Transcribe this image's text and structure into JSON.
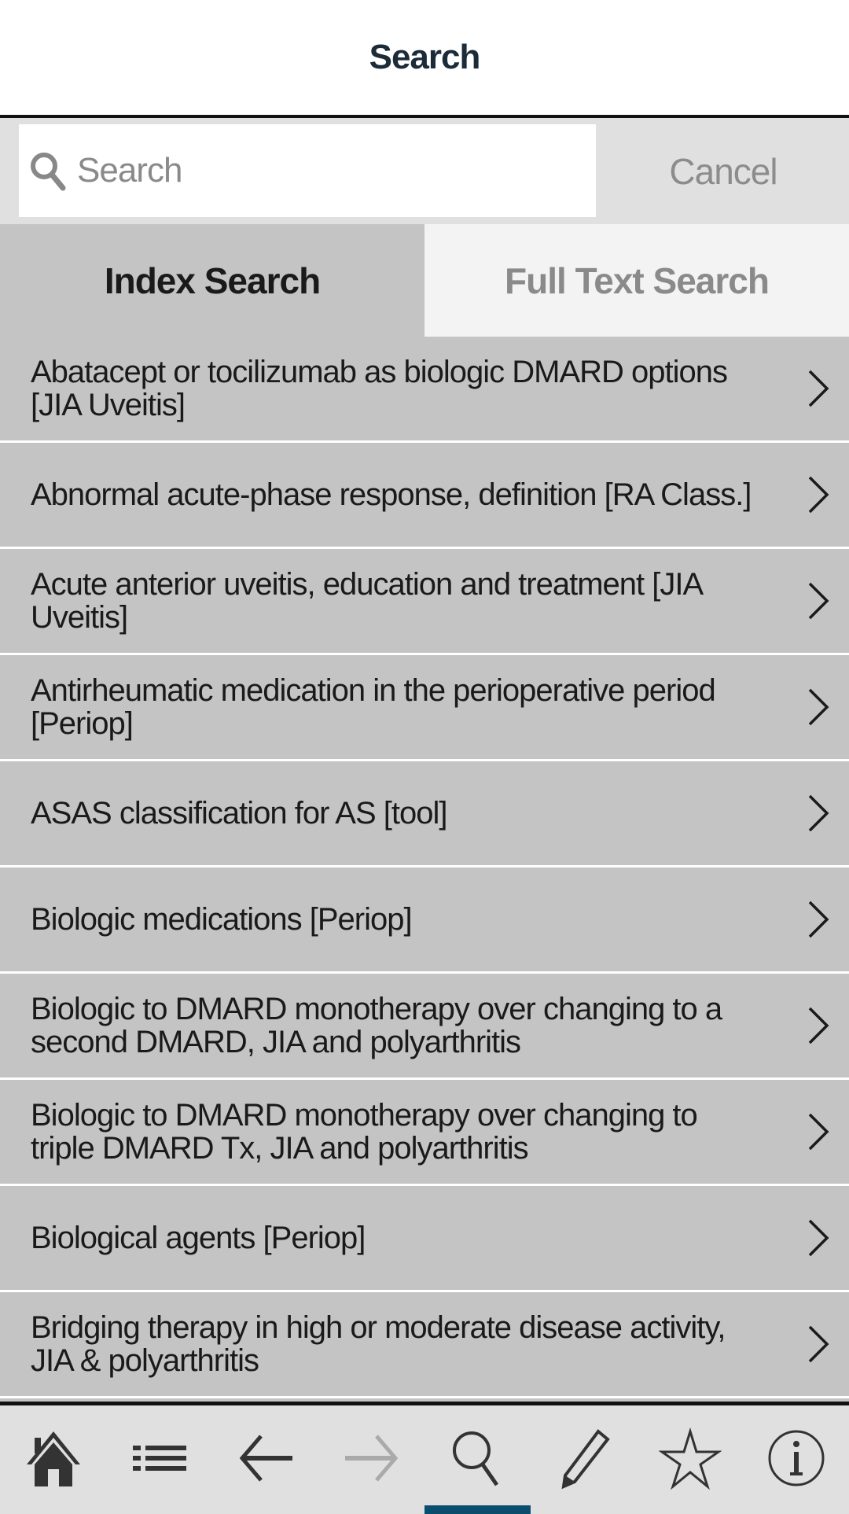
{
  "header": {
    "title": "Search"
  },
  "search": {
    "placeholder": "Search",
    "value": "",
    "cancel_label": "Cancel"
  },
  "tabs": [
    {
      "label": "Index Search",
      "active": true
    },
    {
      "label": "Full Text Search",
      "active": false
    }
  ],
  "results": [
    {
      "label": "Abatacept or tocilizumab as biologic DMARD options [JIA Uveitis]"
    },
    {
      "label": "Abnormal acute-phase response, definition [RA Class.]"
    },
    {
      "label": "Acute anterior uveitis, education and treatment [JIA Uveitis]"
    },
    {
      "label": "Antirheumatic medication in the perioperative period [Periop]"
    },
    {
      "label": "ASAS classification for AS [tool]"
    },
    {
      "label": "Biologic medications [Periop]"
    },
    {
      "label": "Biologic to DMARD monotherapy over changing to a second DMARD, JIA and polyarthritis"
    },
    {
      "label": "Biologic to DMARD monotherapy over changing to triple DMARD Tx, JIA and polyarthritis"
    },
    {
      "label": "Biological agents [Periop]"
    },
    {
      "label": "Bridging therapy in high or moderate disease activity, JIA & polyarthritis"
    }
  ],
  "bottom_nav": {
    "items": [
      {
        "icon": "home-icon"
      },
      {
        "icon": "list-icon"
      },
      {
        "icon": "back-arrow-icon"
      },
      {
        "icon": "forward-arrow-icon",
        "disabled": true
      },
      {
        "icon": "search-icon",
        "active": true
      },
      {
        "icon": "pencil-icon"
      },
      {
        "icon": "star-icon"
      },
      {
        "icon": "info-icon"
      }
    ],
    "active_color": "#0b4d6e"
  }
}
